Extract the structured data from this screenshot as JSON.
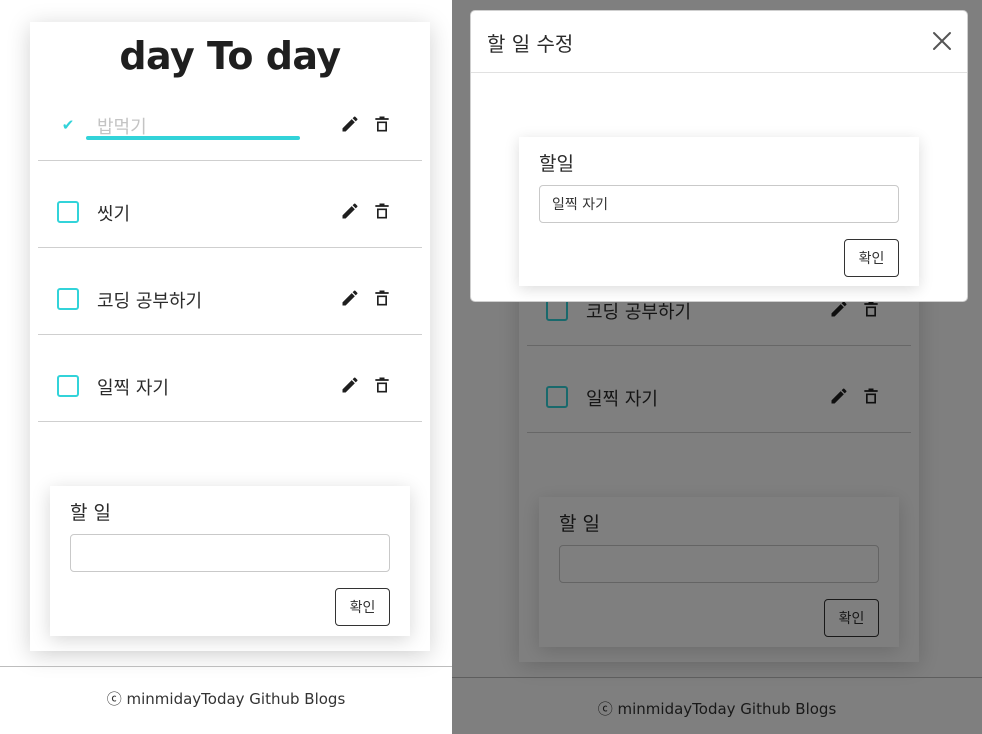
{
  "app": {
    "title": "day To day",
    "accent_color": "#32d3d9"
  },
  "todos": [
    {
      "text": "밥먹기",
      "done": true,
      "edit_icon": "pencil-icon",
      "delete_icon": "trash-icon"
    },
    {
      "text": "씻기",
      "done": false,
      "edit_icon": "pencil-icon",
      "delete_icon": "trash-icon"
    },
    {
      "text": "코딩 공부하기",
      "done": false,
      "edit_icon": "pencil-icon",
      "delete_icon": "trash-icon"
    },
    {
      "text": "일찍 자기",
      "done": false,
      "edit_icon": "pencil-icon",
      "delete_icon": "trash-icon"
    }
  ],
  "add_form": {
    "label": "할 일",
    "value": "",
    "confirm_label": "확인"
  },
  "footer": {
    "text": "ⓒ minmidayToday Github Blogs"
  },
  "modal": {
    "title": "할 일 수정",
    "close_icon": "close-icon",
    "label": "할일",
    "value": "일찍 자기",
    "confirm_label": "확인"
  }
}
